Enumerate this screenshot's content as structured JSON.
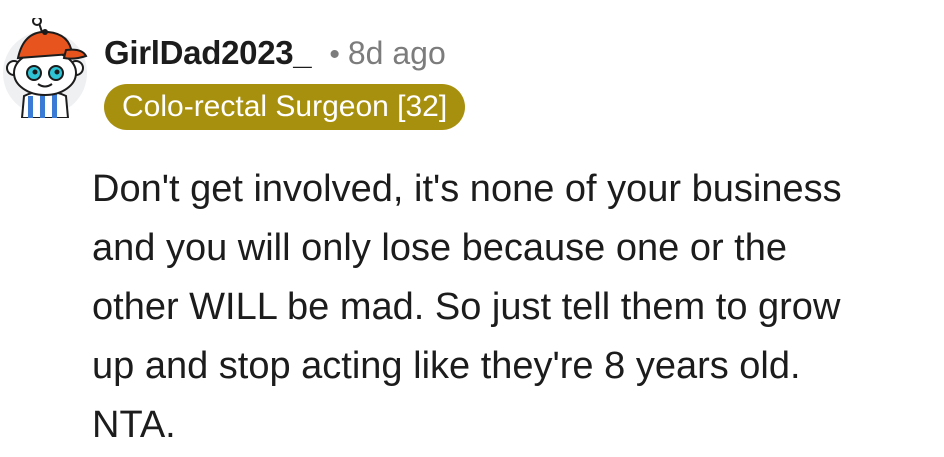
{
  "comment": {
    "author": "GirlDad2023_",
    "separator": "•",
    "age": "8d ago",
    "flair": "Colo-rectal Surgeon [32]",
    "body_lines": [
      "Don't get involved, it's none of your business",
      "and you will only lose because one or the",
      "other WILL be mad. So just tell them to grow",
      "up and stop acting like they're 8 years old.",
      "NTA."
    ]
  },
  "colors": {
    "flair_background": "#a8900f",
    "flair_text": "#ffffff",
    "username": "#1c1c1c",
    "meta_gray": "#7c7c7c",
    "avatar_hat": "#e8541e"
  },
  "icons": {
    "avatar": "snoo-avatar-icon"
  }
}
